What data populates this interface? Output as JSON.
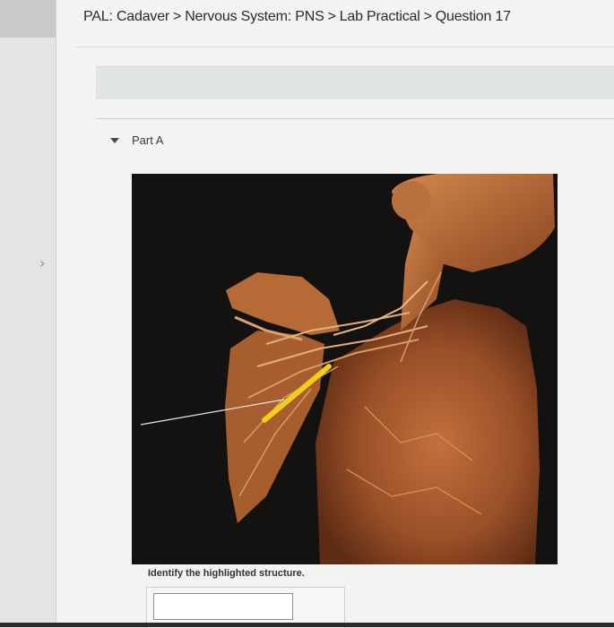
{
  "breadcrumb": {
    "items": [
      "PAL: Cadaver",
      "Nervous System: PNS",
      "Lab Practical",
      "Question 17"
    ],
    "separator": ">"
  },
  "part": {
    "label": "Part A",
    "expanded": true
  },
  "question": {
    "prompt": "Identify the highlighted structure.",
    "answer_value": ""
  },
  "image": {
    "highlight_color": "#f0cf1a"
  },
  "icons": {
    "rail": "chevron-right-icon",
    "part_toggle": "caret-down-icon"
  }
}
